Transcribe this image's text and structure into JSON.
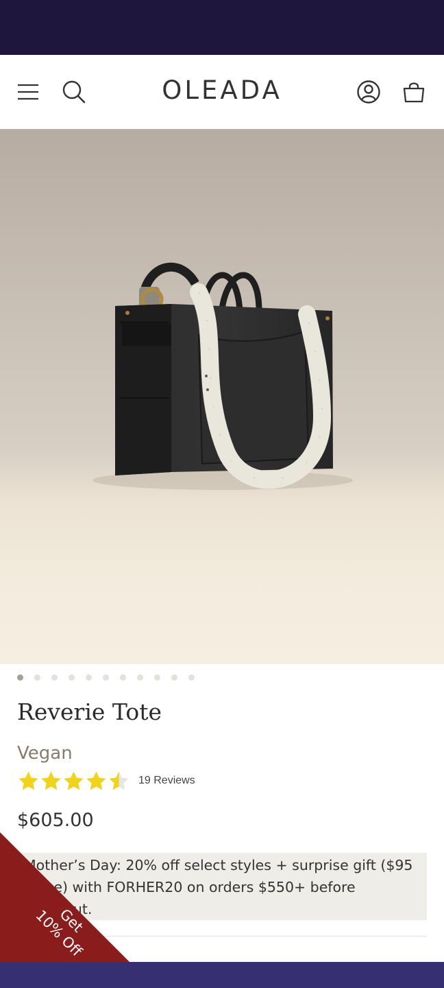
{
  "header": {
    "logo": "OLEADA",
    "icons": [
      "menu-icon",
      "search-icon",
      "account-icon",
      "bag-icon"
    ]
  },
  "gallery": {
    "total_slides": 11,
    "active_slide": 1
  },
  "product": {
    "title": "Reverie Tote",
    "variant": "Vegan",
    "rating": 4.5,
    "rating_max": 5,
    "reviews_label": "19 Reviews",
    "price": "$605.00"
  },
  "promo": {
    "line1": "Mother’s Day: 20% off select styles + surprise gift ($95",
    "line2": "value) with FORHER20 on orders $550+ before",
    "line3": "checkout."
  },
  "badge": {
    "line1": "Get",
    "line2": "10% Off"
  },
  "colors": {
    "top_strip": "#1e163d",
    "star": "#f2d31b",
    "badge": "#8a1c1c",
    "bottom_bar": "#363072"
  }
}
